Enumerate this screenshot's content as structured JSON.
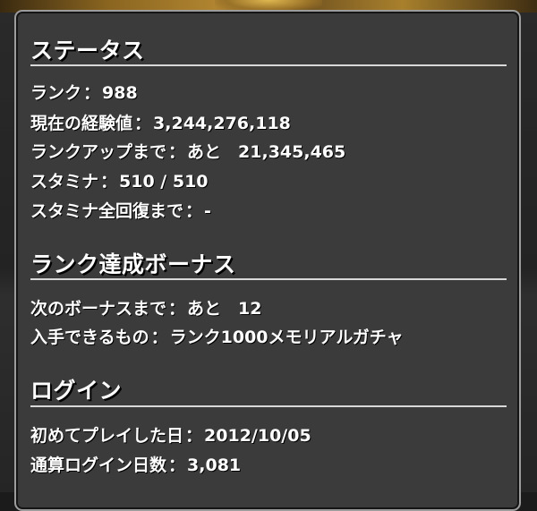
{
  "status": {
    "title": "ステータス",
    "rows": [
      {
        "label": "ランク",
        "sep": "：",
        "value": "988"
      },
      {
        "label": "現在の経験値",
        "sep": "：",
        "value": "3,244,276,118"
      },
      {
        "label": "ランクアップまで",
        "sep": "：",
        "value": "あと　21,345,465"
      },
      {
        "label": "スタミナ",
        "sep": "：",
        "value": "510 / 510"
      },
      {
        "label": "スタミナ全回復まで",
        "sep": "：",
        "value": "-"
      }
    ]
  },
  "rank_bonus": {
    "title": "ランク達成ボーナス",
    "rows": [
      {
        "label": "次のボーナスまで",
        "sep": "：",
        "value": "あと　12"
      },
      {
        "label": "入手できるもの",
        "sep": "：",
        "value": "ランク1000メモリアルガチャ"
      }
    ]
  },
  "login": {
    "title": "ログイン",
    "rows": [
      {
        "label": "初めてプレイした日",
        "sep": "：",
        "value": "2012/10/05"
      },
      {
        "label": "通算ログイン日数",
        "sep": "：",
        "value": "3,081"
      }
    ]
  }
}
